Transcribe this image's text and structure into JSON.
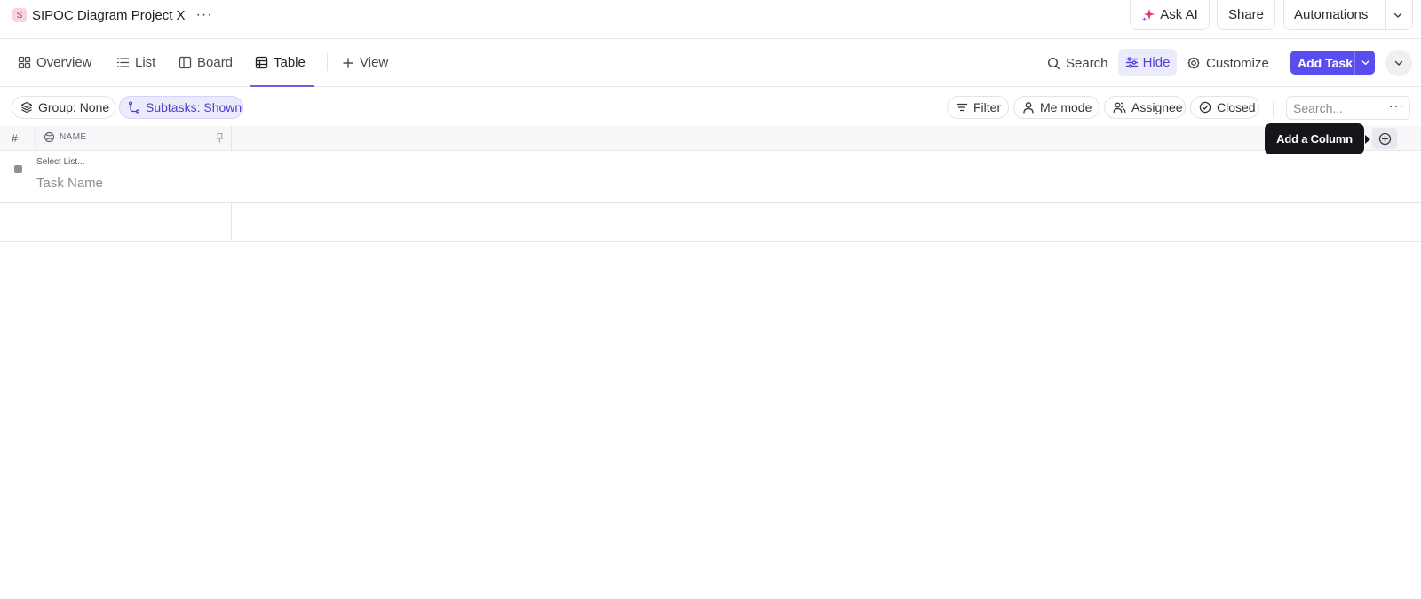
{
  "project": {
    "avatar_letter": "S",
    "name": "SIPOC Diagram Project X",
    "more": "···"
  },
  "header": {
    "ask_ai": "Ask AI",
    "share": "Share",
    "automations": "Automations"
  },
  "tabs": [
    {
      "label": "Overview",
      "icon": "overview-icon"
    },
    {
      "label": "List",
      "icon": "list-icon"
    },
    {
      "label": "Board",
      "icon": "board-icon"
    },
    {
      "label": "Table",
      "icon": "table-icon",
      "active": true
    },
    {
      "label": "View",
      "icon": "plus-icon"
    }
  ],
  "toolbar": {
    "search": "Search",
    "hide": "Hide",
    "customize": "Customize",
    "add_task": "Add Task"
  },
  "filters": {
    "group": "Group: None",
    "subtasks": "Subtasks: Shown",
    "filter": "Filter",
    "me_mode": "Me mode",
    "assignee": "Assignee",
    "closed": "Closed",
    "search_placeholder": "Search...",
    "more": "···"
  },
  "table": {
    "col_number": "#",
    "col_name": "NAME",
    "add_column_tooltip": "Add a Column",
    "new_row": {
      "list_selector": "Select List...",
      "task_placeholder": "Task Name"
    }
  },
  "colors": {
    "accent": "#5b4cf0",
    "accent_soft": "#ecebfc",
    "tooltip_bg": "#16161a"
  }
}
